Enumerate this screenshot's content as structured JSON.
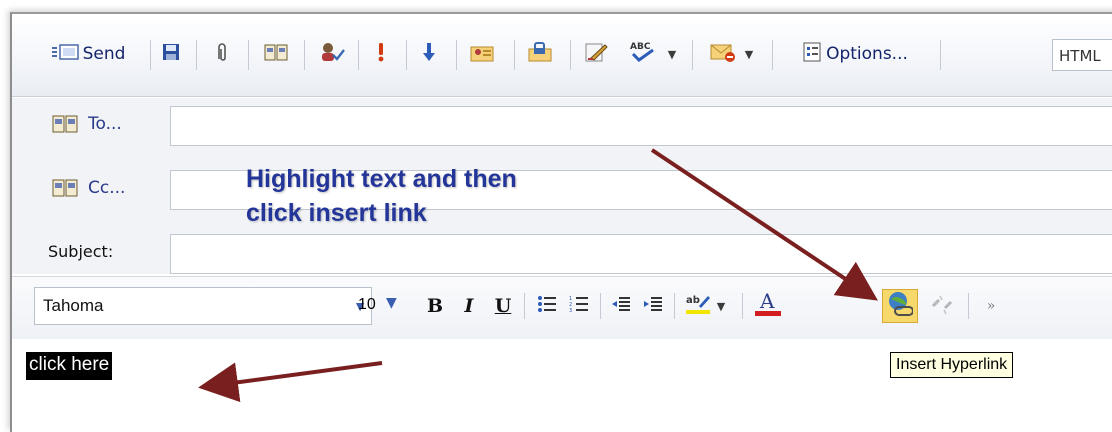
{
  "toolbar": {
    "send_label": "Send",
    "options_label": "Options...",
    "format_label": "HTML"
  },
  "header": {
    "to_label": "To...",
    "cc_label": "Cc...",
    "subject_label": "Subject:"
  },
  "format_bar": {
    "font_name": "Tahoma",
    "font_size": "10",
    "bold_label": "B",
    "italic_label": "I",
    "underline_label": "U"
  },
  "body": {
    "selected_text": "click here"
  },
  "tooltip": {
    "text": "Insert Hyperlink"
  },
  "annotation": {
    "line1": "Highlight text and then",
    "line2": "click insert link"
  },
  "colors": {
    "annotation_text": "#24359a",
    "arrow": "#7a1f1f",
    "highlight_button": "#f7d86a",
    "tooltip_bg": "#ffffe1"
  }
}
